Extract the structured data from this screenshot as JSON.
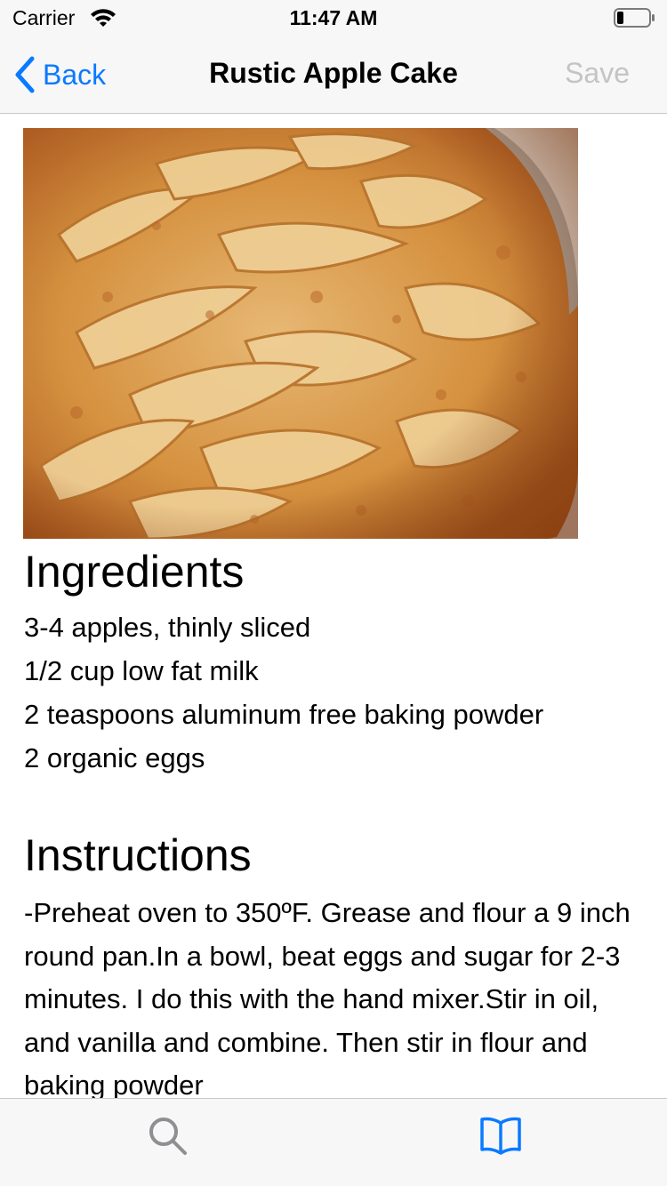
{
  "status_bar": {
    "carrier": "Carrier",
    "time": "11:47 AM"
  },
  "nav": {
    "back_label": "Back",
    "title": "Rustic Apple Cake",
    "save_label": "Save"
  },
  "recipe": {
    "ingredients_heading": "Ingredients",
    "ingredients": [
      "3-4 apples, thinly sliced",
      "1/2 cup low fat milk",
      "2 teaspoons aluminum free baking powder",
      "2 organic eggs"
    ],
    "instructions_heading": "Instructions",
    "instructions": "-Preheat oven to 350ºF. Grease and flour a 9 inch round pan.In a bowl, beat eggs and sugar for 2-3 minutes. I do this with the hand mixer.Stir in oil, and vanilla and combine. Then stir in flour and baking powder"
  },
  "tab_bar": {
    "items": [
      {
        "icon": "search-icon",
        "selected": false
      },
      {
        "icon": "book-icon",
        "selected": true
      }
    ]
  },
  "colors": {
    "accent": "#0a7aff",
    "disabled": "#c4c4c7",
    "bar_background": "#f7f7f7",
    "inactive_icon": "#8e8e93"
  }
}
